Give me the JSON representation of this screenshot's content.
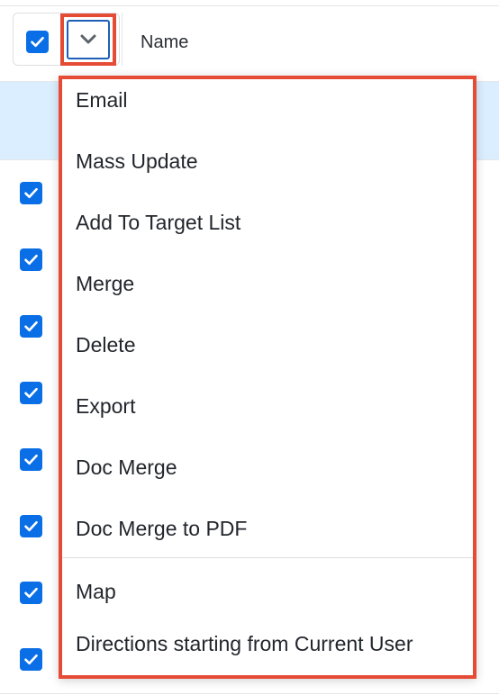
{
  "header": {
    "name_column": "Name",
    "select_all_checked": true
  },
  "rows": [
    {
      "checked": true
    },
    {
      "checked": true
    },
    {
      "checked": true
    },
    {
      "checked": true
    },
    {
      "checked": true
    },
    {
      "checked": true
    },
    {
      "checked": true
    },
    {
      "checked": true
    }
  ],
  "mass_actions_menu": {
    "items": [
      {
        "label": "Email"
      },
      {
        "label": "Mass Update"
      },
      {
        "label": "Add To Target List"
      },
      {
        "label": "Merge"
      },
      {
        "label": "Delete"
      },
      {
        "label": "Export"
      },
      {
        "label": "Doc Merge"
      },
      {
        "label": "Doc Merge to PDF"
      },
      {
        "label": "Map"
      },
      {
        "label": "Directions starting from Current User"
      }
    ]
  },
  "icons": {
    "checkbox": "checkmark-icon",
    "dropdown_toggle": "chevron-down-icon"
  },
  "colors": {
    "accent_blue": "#0a6fe6",
    "highlight_red": "#e64b35",
    "selected_row": "#dbeeff"
  }
}
